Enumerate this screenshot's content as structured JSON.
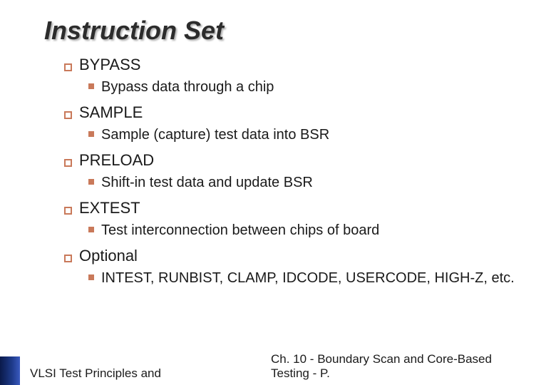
{
  "title": "Instruction Set",
  "sections": [
    {
      "label": "BYPASS",
      "detail": "Bypass data through a chip"
    },
    {
      "label": "SAMPLE",
      "detail": "Sample (capture) test data into BSR"
    },
    {
      "label": "PRELOAD",
      "detail": "Shift-in test data and update BSR"
    },
    {
      "label": "EXTEST",
      "detail": "Test interconnection between chips of board"
    },
    {
      "label": "Optional",
      "detail": "INTEST, RUNBIST, CLAMP, IDCODE, USERCODE, HIGH-Z, etc."
    }
  ],
  "footer": {
    "left": "VLSI Test Principles and",
    "right_line1": "Ch. 10 - Boundary Scan and Core-Based",
    "right_line2": "Testing - P."
  },
  "colors": {
    "bullet": "#c9795a",
    "sidebar_dark": "#0a1a4a"
  }
}
